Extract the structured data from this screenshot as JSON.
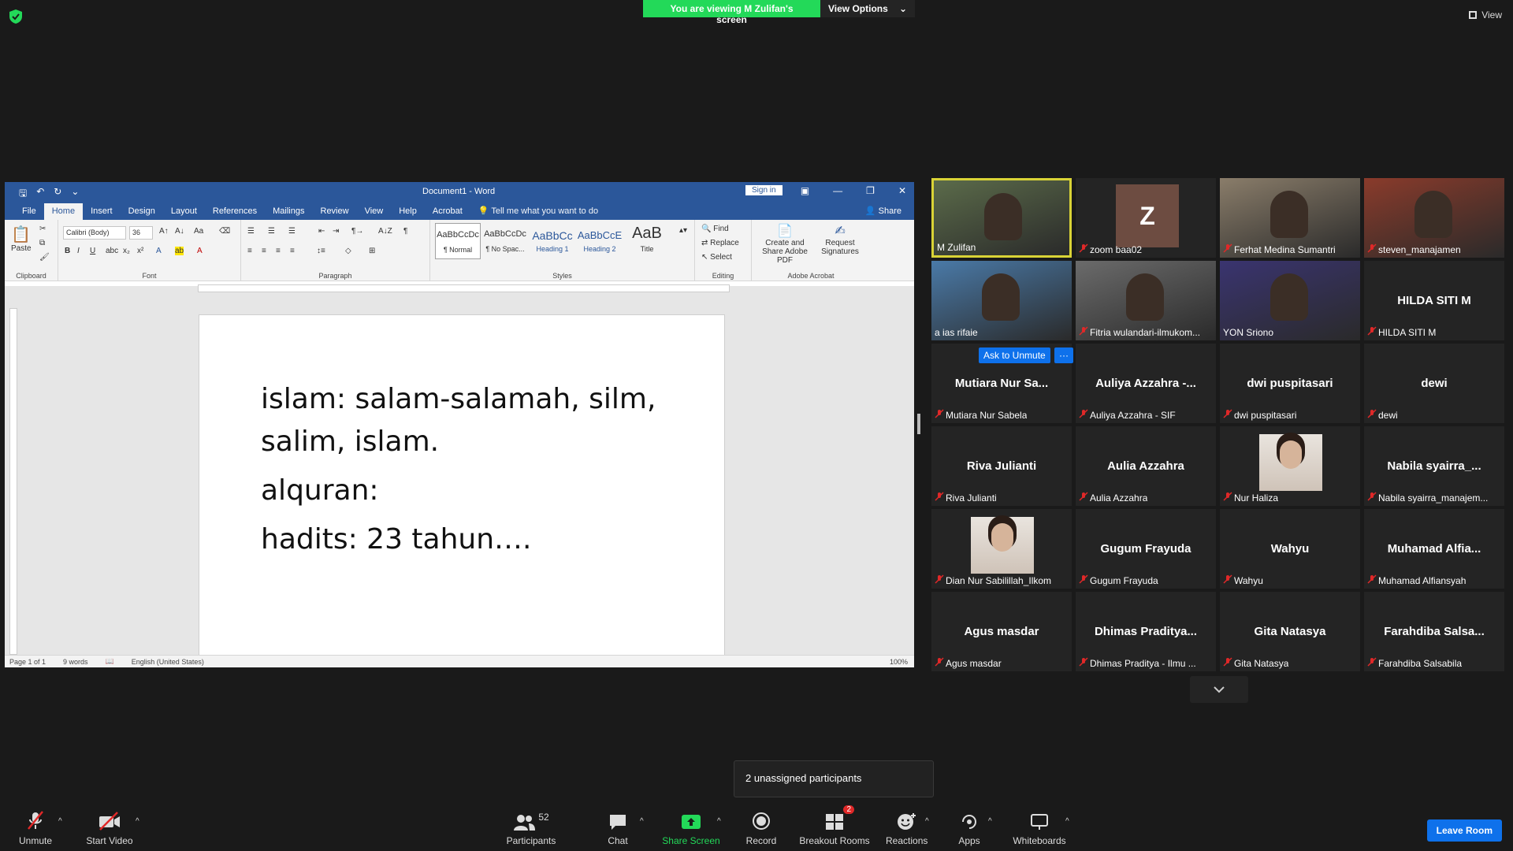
{
  "top": {
    "viewing_banner": "You are viewing M Zulifan's screen",
    "view_options": "View Options",
    "view_button": "View"
  },
  "word": {
    "title": "Document1 - Word",
    "sign_in": "Sign in",
    "share": "Share",
    "tabs": [
      "File",
      "Home",
      "Insert",
      "Design",
      "Layout",
      "References",
      "Mailings",
      "Review",
      "View",
      "Help",
      "Acrobat"
    ],
    "tell_me": "Tell me what you want to do",
    "font_name": "Calibri (Body)",
    "font_size": "36",
    "groups": {
      "clipboard": "Clipboard",
      "font": "Font",
      "paragraph": "Paragraph",
      "styles": "Styles",
      "editing": "Editing",
      "acrobat": "Adobe Acrobat"
    },
    "paste": "Paste",
    "styles": [
      {
        "preview": "AaBbCcDc",
        "name": "¶ Normal"
      },
      {
        "preview": "AaBbCcDc",
        "name": "¶ No Spac..."
      },
      {
        "preview": "AaBbCc",
        "name": "Heading 1"
      },
      {
        "preview": "AaBbCcE",
        "name": "Heading 2"
      },
      {
        "preview": "AaB",
        "name": "Title"
      }
    ],
    "editing": {
      "find": "Find",
      "replace": "Replace",
      "select": "Select"
    },
    "acrobat": {
      "create": "Create and Share Adobe PDF",
      "request": "Request Signatures"
    },
    "doc_lines": [
      "islam: salam-salamah, silm,",
      "salim, islam.",
      "alquran:",
      "hadits: 23 tahun…."
    ],
    "status": {
      "page": "Page 1 of 1",
      "words": "9 words",
      "language": "English (United States)",
      "zoom": "100%"
    }
  },
  "participants": [
    {
      "name": "M Zulifan",
      "label": "M Zulifan",
      "kind": "video",
      "highlight": true
    },
    {
      "name": "Z",
      "label": "zoom baa02",
      "kind": "letter"
    },
    {
      "name": "Ferhat Medina Sumantri",
      "label": "Ferhat Medina Sumantri",
      "kind": "video"
    },
    {
      "name": "steven_manajamen",
      "label": "steven_manajamen",
      "kind": "video"
    },
    {
      "name": "a ias rifaie",
      "label": "a ias rifaie",
      "kind": "video"
    },
    {
      "name": "Fitria wulandari-ilmukom...",
      "label": "Fitria wulandari-ilmukom...",
      "kind": "video"
    },
    {
      "name": "YON Sriono",
      "label": "YON Sriono",
      "kind": "video"
    },
    {
      "name": "HILDA SITI M",
      "label": "HILDA SITI M",
      "kind": "name"
    },
    {
      "name": "Mutiara Nur Sa...",
      "label": "Mutiara Nur Sabela",
      "kind": "name"
    },
    {
      "name": "Auliya Azzahra -...",
      "label": "Auliya Azzahra - SIF",
      "kind": "name"
    },
    {
      "name": "dwi puspitasari",
      "label": "dwi puspitasari",
      "kind": "name"
    },
    {
      "name": "dewi",
      "label": "dewi",
      "kind": "name"
    },
    {
      "name": "Riva Julianti",
      "label": "Riva Julianti",
      "kind": "name"
    },
    {
      "name": "Aulia Azzahra",
      "label": "Aulia Azzahra",
      "kind": "name"
    },
    {
      "name": "Nur Haliza",
      "label": "Nur Haliza",
      "kind": "photo"
    },
    {
      "name": "Nabila syairra_...",
      "label": "Nabila syairra_manajem...",
      "kind": "name"
    },
    {
      "name": "Dian Nur Sabilillah_Ilkom",
      "label": "Dian Nur Sabilillah_Ilkom",
      "kind": "photo"
    },
    {
      "name": "Gugum Frayuda",
      "label": "Gugum Frayuda",
      "kind": "name"
    },
    {
      "name": "Wahyu",
      "label": "Wahyu",
      "kind": "name"
    },
    {
      "name": "Muhamad Alfia...",
      "label": "Muhamad Alfiansyah",
      "kind": "name"
    },
    {
      "name": "Agus masdar",
      "label": "Agus masdar",
      "kind": "name"
    },
    {
      "name": "Dhimas Praditya...",
      "label": "Dhimas Praditya - Ilmu ...",
      "kind": "name"
    },
    {
      "name": "Gita Natasya",
      "label": "Gita Natasya",
      "kind": "name"
    },
    {
      "name": "Farahdiba Salsa...",
      "label": "Farahdiba Salsabila",
      "kind": "name"
    }
  ],
  "ask_to_unmute": "Ask to Unmute",
  "ask_more": "···",
  "popup": "2 unassigned participants",
  "toolbar": {
    "unmute": "Unmute",
    "start_video": "Start Video",
    "participants": "Participants",
    "participants_count": "52",
    "chat": "Chat",
    "share_screen": "Share Screen",
    "record": "Record",
    "breakout": "Breakout Rooms",
    "breakout_badge": "2",
    "reactions": "Reactions",
    "apps": "Apps",
    "whiteboards": "Whiteboards",
    "leave": "Leave Room"
  }
}
